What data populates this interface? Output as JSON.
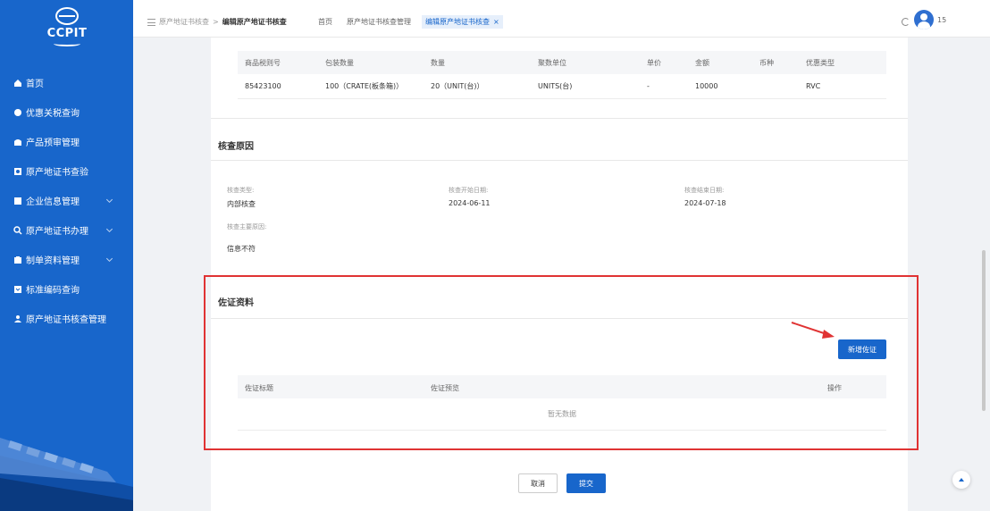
{
  "logo": {
    "text": "CCPIT"
  },
  "sidebar": {
    "items": [
      {
        "label": "首页",
        "icon": "home-icon",
        "has_chevron": false
      },
      {
        "label": "优惠关税查询",
        "icon": "search-icon",
        "has_chevron": false
      },
      {
        "label": "产品预审管理",
        "icon": "product-icon",
        "has_chevron": false
      },
      {
        "label": "原产地证书查验",
        "icon": "certificate-icon",
        "has_chevron": false
      },
      {
        "label": "企业信息管理",
        "icon": "company-icon",
        "has_chevron": true
      },
      {
        "label": "原产地证书办理",
        "icon": "apply-icon",
        "has_chevron": true
      },
      {
        "label": "制单资料管理",
        "icon": "document-icon",
        "has_chevron": true
      },
      {
        "label": "标准编码查询",
        "icon": "code-icon",
        "has_chevron": false
      },
      {
        "label": "原产地证书核查管理",
        "icon": "user-icon",
        "has_chevron": false
      }
    ]
  },
  "breadcrumb": {
    "parent": "原产地证书核查",
    "separator": ">",
    "current": "编辑原产地证书核查"
  },
  "tabs": [
    {
      "label": "首页",
      "active": false
    },
    {
      "label": "原产地证书核查管理",
      "active": false
    },
    {
      "label": "编辑原产地证书核查",
      "active": true,
      "close": "×"
    }
  ],
  "user": {
    "name": "15"
  },
  "product_table": {
    "headers": [
      "商品税则号",
      "包装数量",
      "数量",
      "聚数单位",
      "单价",
      "金额",
      "币种",
      "优惠类型"
    ],
    "rows": [
      [
        "85423100",
        "100（CRATE(板条箱)）",
        "20（UNIT(台)）",
        "UNITS(台)",
        "-",
        "10000",
        "",
        "RVC"
      ]
    ]
  },
  "verify_reason": {
    "title": "核查原因",
    "type_label": "核查类型:",
    "type_value": "内部核查",
    "start_label": "核查开始日期:",
    "start_value": "2024-06-11",
    "end_label": "核查结束日期:",
    "end_value": "2024-07-18",
    "main_reason_label": "核查主要原因:",
    "main_reason_value": "信息不符"
  },
  "evidence": {
    "title": "佐证资料",
    "add_button": "新增佐证",
    "headers": [
      "佐证标题",
      "佐证预览",
      "操作"
    ],
    "empty_text": "暂无数据"
  },
  "footer": {
    "cancel": "取消",
    "submit": "提交"
  },
  "colors": {
    "primary": "#1866cb",
    "highlight": "#e03333"
  }
}
